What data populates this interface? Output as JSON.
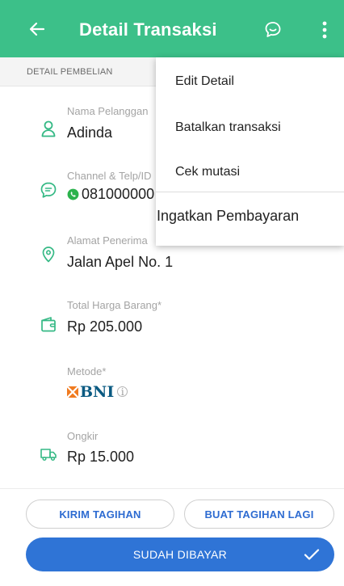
{
  "app_bar": {
    "title": "Detail Transaksi",
    "background": "#3cc089",
    "icons": [
      "arrow-back-icon",
      "chat-icon",
      "more-vertical-icon"
    ]
  },
  "section": {
    "header": "DETAIL PEMBELIAN"
  },
  "fields": [
    {
      "label": "Nama Pelanggan",
      "value": "Adinda",
      "icon": "person-icon"
    },
    {
      "label": "Channel & Telp/ID",
      "value": "081000000",
      "icon": "chat-bubble-icon",
      "value_icon": "whatsapp-icon"
    },
    {
      "label": "Alamat Penerima",
      "value": "Jalan Apel No. 1",
      "icon": "location-pin-icon"
    },
    {
      "label": "Total Harga Barang*",
      "value": "Rp 205.000",
      "icon": "wallet-icon"
    },
    {
      "label": "Metode*",
      "value": "BNI",
      "value_icon": "bni-logo",
      "info_icon": "info-icon"
    },
    {
      "label": "Ongkir",
      "value": "Rp 15.000",
      "icon": "truck-icon"
    }
  ],
  "actions": {
    "kirim_tagihan": "KIRIM TAGIHAN",
    "buat_tagihan_lagi": "BUAT TAGIHAN LAGI",
    "sudah_dibayar": "SUDAH DIBAYAR",
    "primary_color": "#2f74d6"
  },
  "menu": {
    "items": [
      "Edit Detail",
      "Batalkan transaksi",
      "Cek mutasi",
      "Ingatkan Pembayaran"
    ]
  }
}
